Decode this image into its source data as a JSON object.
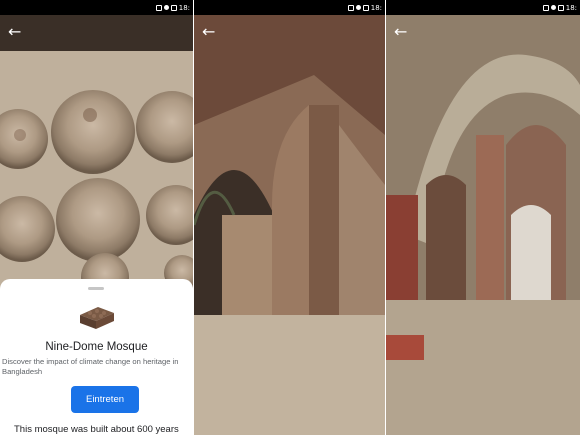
{
  "status_bar": {
    "time": "18:"
  },
  "panels": [
    {
      "name": "ceiling-domes",
      "back_icon": "arrow-left-icon"
    },
    {
      "name": "interior-corner",
      "back_icon": "arrow-left-icon"
    },
    {
      "name": "interior-arches",
      "back_icon": "arrow-left-icon"
    }
  ],
  "sheet": {
    "title": "Nine-Dome Mosque",
    "subtitle": "Discover the impact of climate change on heritage in Bangladesh",
    "button_label": "Eintreten",
    "body": "This mosque was built about 600 years"
  },
  "colors": {
    "accent": "#1a73e8",
    "status_bar": "#000000"
  }
}
